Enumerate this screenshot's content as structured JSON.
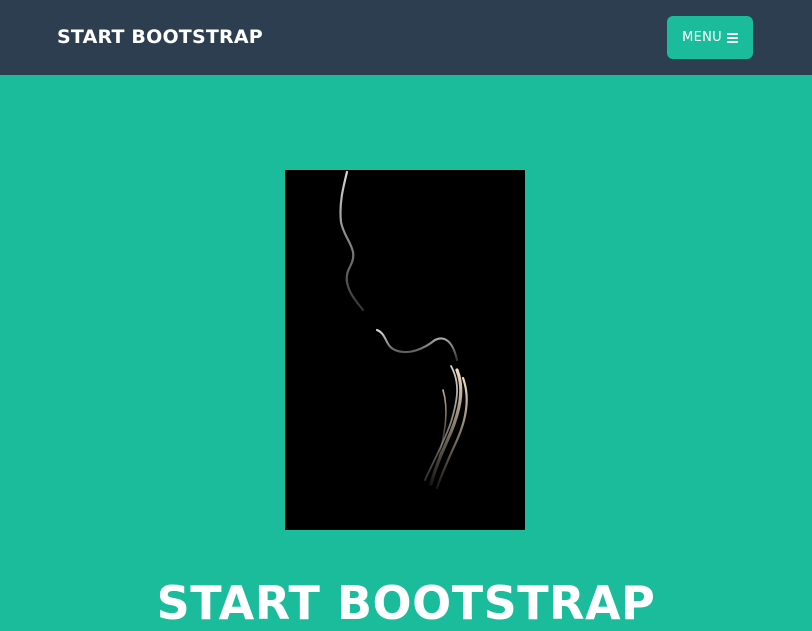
{
  "navbar": {
    "brand": "START BOOTSTRAP",
    "menu_label": "MENU",
    "menu_icon": "bars-icon"
  },
  "masthead": {
    "image_alt_semantic": "profile-silhouette-image",
    "title": "START BOOTSTRAP"
  },
  "colors": {
    "navbar_bg": "#2c3e50",
    "accent": "#1abc9c",
    "text": "#ffffff",
    "image_bg": "#000000"
  }
}
